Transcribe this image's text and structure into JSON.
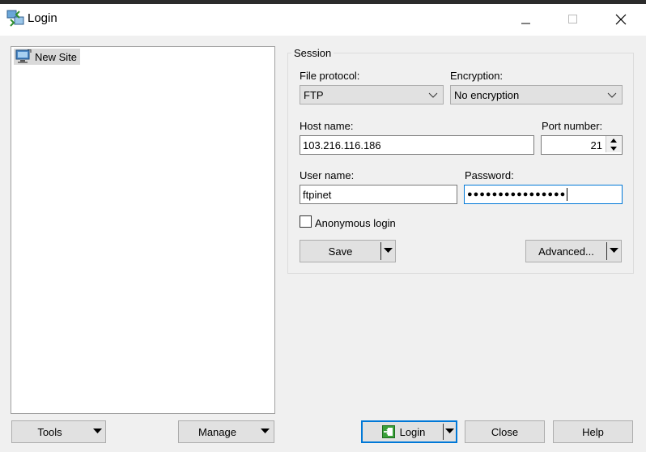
{
  "window": {
    "title": "Login"
  },
  "tree": {
    "items": [
      {
        "label": "New Site"
      }
    ]
  },
  "session": {
    "legend": "Session",
    "file_protocol_label": "File protocol:",
    "file_protocol_value": "FTP",
    "encryption_label": "Encryption:",
    "encryption_value": "No encryption",
    "host_label": "Host name:",
    "host_value": "103.216.116.186",
    "port_label": "Port number:",
    "port_value": "21",
    "user_label": "User name:",
    "user_value": "ftpinet",
    "password_label": "Password:",
    "password_mask": "●●●●●●●●●●●●●●●●",
    "anonymous_label": "Anonymous login",
    "anonymous_checked": false,
    "save_label": "Save",
    "advanced_label": "Advanced..."
  },
  "footer": {
    "tools_label": "Tools",
    "manage_label": "Manage",
    "login_label": "Login",
    "close_label": "Close",
    "help_label": "Help"
  },
  "colors": {
    "accent": "#0078d7",
    "login_icon": "#3aa03a"
  }
}
